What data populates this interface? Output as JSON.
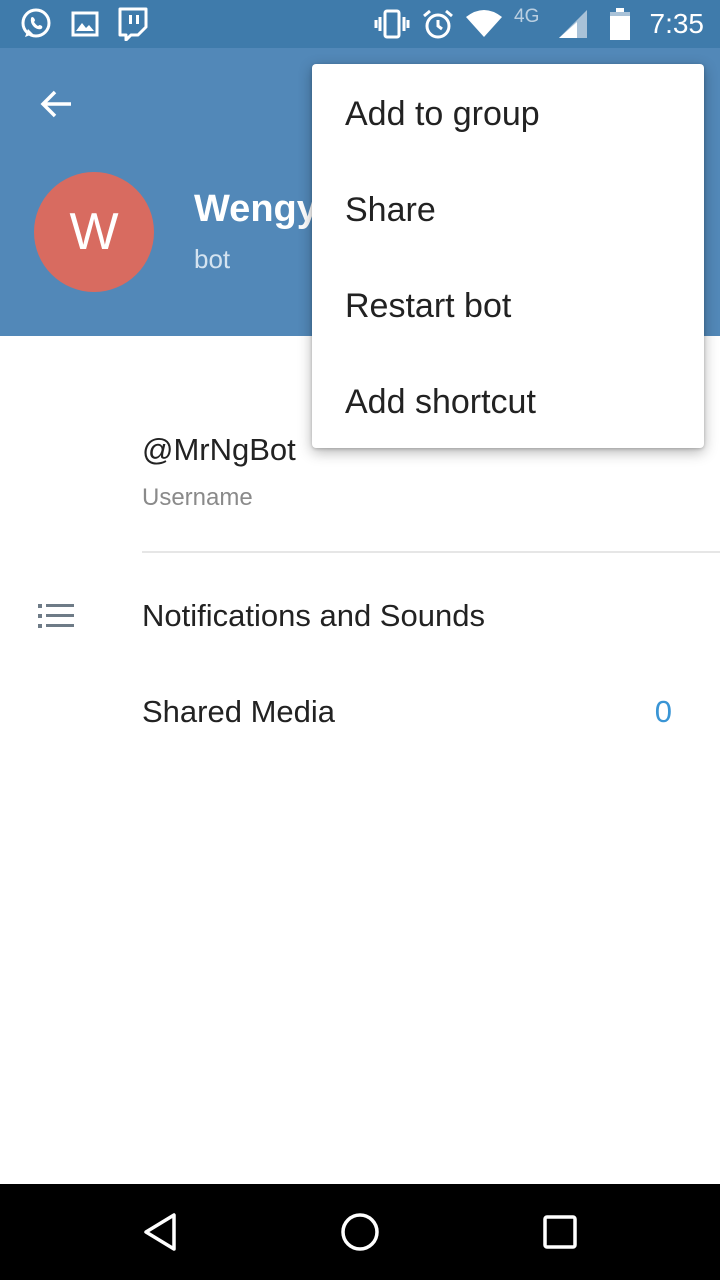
{
  "status_bar": {
    "time": "7:35",
    "network": "4G",
    "icons": [
      "whatsapp-icon",
      "gallery-icon",
      "twitch-icon",
      "vibrate-icon",
      "alarm-icon",
      "wifi-icon",
      "signal-icon",
      "battery-icon"
    ]
  },
  "header": {
    "avatar_letter": "W",
    "name": "Wengy",
    "status": "bot",
    "avatar_color": "#d86b60",
    "background_color": "#5288b8"
  },
  "info": {
    "username": "@MrNgBot",
    "username_label": "Username"
  },
  "rows": {
    "notifications_label": "Notifications and Sounds",
    "shared_media_label": "Shared Media",
    "shared_media_count": "0"
  },
  "menu": {
    "items": [
      "Add to group",
      "Share",
      "Restart bot",
      "Add shortcut"
    ]
  },
  "colors": {
    "accent": "#3a95d5",
    "status_bar": "#3f7bab"
  }
}
